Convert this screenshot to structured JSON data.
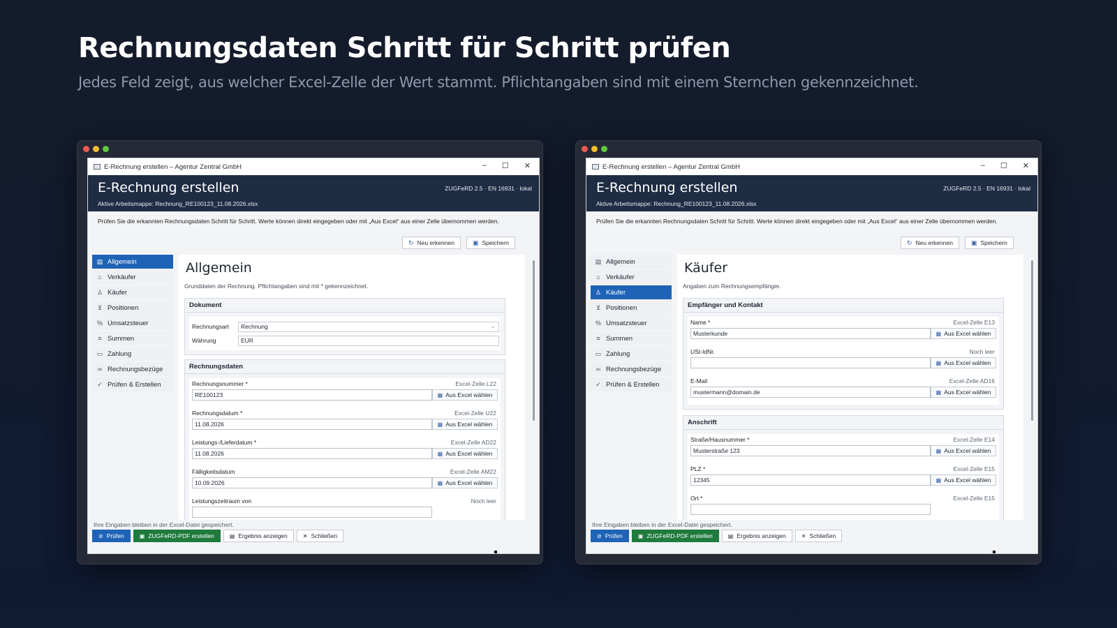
{
  "hero": {
    "title": "Rechnungsdaten Schritt für Schritt prüfen",
    "subtitle": "Jedes Feld zeigt, aus welcher Excel-Zelle der Wert stammt. Pflichtangaben sind mit einem Sternchen gekennzeichnet."
  },
  "window": {
    "title": "E-Rechnung erstellen – Agentur Zentral GmbH",
    "header_title": "E-Rechnung erstellen",
    "header_badge": "ZUGFeRD 2.5 · EN 16931 · lokal",
    "active_workbook": "Aktive Arbeitsmappe: Rechnung_RE100123_11.08.2026.xlsx",
    "intro": "Prüfen Sie die erkannten Rechnungsdaten Schritt für Schritt. Werte können direkt eingegeben oder mit „Aus Excel“ aus einer Zelle übernommen werden.",
    "btn_rescan": "Neu erkennen",
    "btn_save": "Speichern",
    "footer_note": "Ihre Eingaben bleiben in der Excel-Datei gespeichert.",
    "btn_check": "Prüfen",
    "btn_create": "ZUGFeRD-PDF erstellen",
    "btn_result": "Ergebnis anzeigen",
    "btn_close": "Schließen",
    "from_excel": "Aus Excel wählen",
    "nav": [
      {
        "label": "Allgemein",
        "icon": "document-icon"
      },
      {
        "label": "Verkäufer",
        "icon": "building-icon"
      },
      {
        "label": "Käufer",
        "icon": "person-icon"
      },
      {
        "label": "Positionen",
        "icon": "cart-icon"
      },
      {
        "label": "Umsatzsteuer",
        "icon": "percent-icon"
      },
      {
        "label": "Summen",
        "icon": "sum-icon"
      },
      {
        "label": "Zahlung",
        "icon": "card-icon"
      },
      {
        "label": "Rechnungsbezüge",
        "icon": "link-icon"
      },
      {
        "label": "Prüfen & Erstellen",
        "icon": "check-circle-icon"
      }
    ]
  },
  "left": {
    "page_title": "Allgemein",
    "page_desc": "Grunddaten der Rechnung. Pflichtangaben sind mit * gekennzeichnet.",
    "section1": {
      "title": "Dokument",
      "rows": [
        {
          "label": "Rechnungsart",
          "value": "Rechnung"
        },
        {
          "label": "Währung",
          "value": "EUR"
        }
      ]
    },
    "section2": {
      "title": "Rechnungsdaten",
      "fields": [
        {
          "label": "Rechnungsnummer *",
          "source": "Excel-Zelle L22",
          "value": "RE100123"
        },
        {
          "label": "Rechnungsdatum *",
          "source": "Excel-Zelle U22",
          "value": "11.08.2026"
        },
        {
          "label": "Leistungs-/Lieferdatum *",
          "source": "Excel-Zelle AD22",
          "value": "11.08.2026"
        },
        {
          "label": "Fälligkeitsdatum",
          "source": "Excel-Zelle AM22",
          "value": "10.09.2026"
        },
        {
          "label": "Leistungszeitraum von",
          "source": "Noch leer",
          "value": ""
        }
      ]
    }
  },
  "right": {
    "page_title": "Käufer",
    "page_desc": "Angaben zum Rechnungsempfänger.",
    "section1": {
      "title": "Empfänger und Kontakt",
      "fields": [
        {
          "label": "Name *",
          "source": "Excel-Zelle E13",
          "value": "Musterkunde"
        },
        {
          "label": "USt-IdNr.",
          "source": "Noch leer",
          "value": ""
        },
        {
          "label": "E-Mail",
          "source": "Excel-Zelle AD16",
          "value": "mustermann@domain.de"
        }
      ]
    },
    "section2": {
      "title": "Anschrift",
      "fields": [
        {
          "label": "Straße/Hausnummer *",
          "source": "Excel-Zelle E14",
          "value": "Musterstraße 123"
        },
        {
          "label": "PLZ *",
          "source": "Excel-Zelle E15",
          "value": "12345"
        },
        {
          "label": "Ort *",
          "source": "Excel-Zelle E15",
          "value": ""
        }
      ]
    }
  }
}
